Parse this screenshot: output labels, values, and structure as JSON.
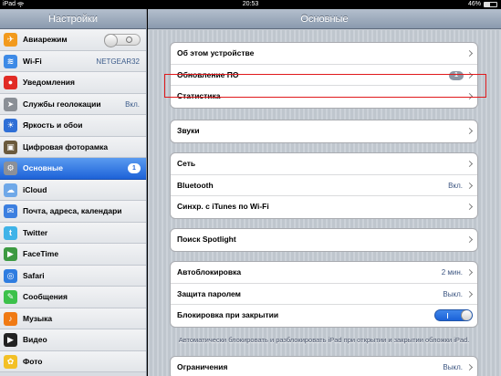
{
  "status_bar": {
    "device": "iPad",
    "time": "20:53",
    "battery": "46%",
    "battery_level": 0.46
  },
  "sidebar": {
    "title": "Настройки",
    "items": [
      {
        "label": "Авиарежим",
        "icon": "airplane-icon",
        "color": "#f29a1d",
        "glyph": "✈",
        "toggle": "off"
      },
      {
        "label": "Wi-Fi",
        "icon": "wifi-icon",
        "color": "#3d8ae6",
        "glyph": "≋",
        "value": "NETGEAR32"
      },
      {
        "label": "Уведомления",
        "icon": "notifications-icon",
        "color": "#e12b25",
        "glyph": "●"
      },
      {
        "label": "Службы геолокации",
        "icon": "location-icon",
        "color": "#8a8f96",
        "glyph": "➤",
        "value": "Вкл."
      },
      {
        "label": "Яркость и обои",
        "icon": "brightness-icon",
        "color": "#2f6fd6",
        "glyph": "☀"
      },
      {
        "label": "Цифровая фоторамка",
        "icon": "photo-frame-icon",
        "color": "#6b5a3c",
        "glyph": "▣"
      },
      {
        "label": "Основные",
        "icon": "gear-icon",
        "color": "#8c9098",
        "glyph": "⚙",
        "badge": "1",
        "selected": true
      },
      {
        "label": "iCloud",
        "icon": "cloud-icon",
        "color": "#6fa8e8",
        "glyph": "☁"
      },
      {
        "label": "Почта, адреса, календари",
        "icon": "mail-icon",
        "color": "#3c7fe0",
        "glyph": "✉"
      },
      {
        "label": "Twitter",
        "icon": "twitter-icon",
        "color": "#3fb3e8",
        "glyph": "t"
      },
      {
        "label": "FaceTime",
        "icon": "facetime-icon",
        "color": "#3d9a42",
        "glyph": "▶"
      },
      {
        "label": "Safari",
        "icon": "safari-icon",
        "color": "#2f7de0",
        "glyph": "◎"
      },
      {
        "label": "Сообщения",
        "icon": "messages-icon",
        "color": "#3cc14a",
        "glyph": "✎"
      },
      {
        "label": "Музыка",
        "icon": "music-icon",
        "color": "#f07a14",
        "glyph": "♪"
      },
      {
        "label": "Видео",
        "icon": "video-icon",
        "color": "#222222",
        "glyph": "▶"
      },
      {
        "label": "Фото",
        "icon": "photos-icon",
        "color": "#f3c026",
        "glyph": "✿"
      }
    ]
  },
  "main": {
    "title": "Основные",
    "group1": [
      {
        "label": "Об этом устройстве"
      },
      {
        "label": "Обновление ПО",
        "badge": "1"
      },
      {
        "label": "Статистика"
      }
    ],
    "group2": [
      {
        "label": "Звуки"
      }
    ],
    "group3": [
      {
        "label": "Сеть"
      },
      {
        "label": "Bluetooth",
        "value": "Вкл."
      },
      {
        "label": "Синхр. с iTunes по Wi-Fi"
      }
    ],
    "group4": [
      {
        "label": "Поиск Spotlight"
      }
    ],
    "group5": [
      {
        "label": "Автоблокировка",
        "value": "2 мин."
      },
      {
        "label": "Защита паролем",
        "value": "Выкл."
      },
      {
        "label": "Блокировка при закрытии",
        "toggle": "on",
        "toggle_label": "I"
      }
    ],
    "footnote": "Автоматически блокировать и разблокировать iPad при открытии и закрытии обложки iPad.",
    "group6": [
      {
        "label": "Ограничения",
        "value": "Выкл."
      }
    ]
  }
}
